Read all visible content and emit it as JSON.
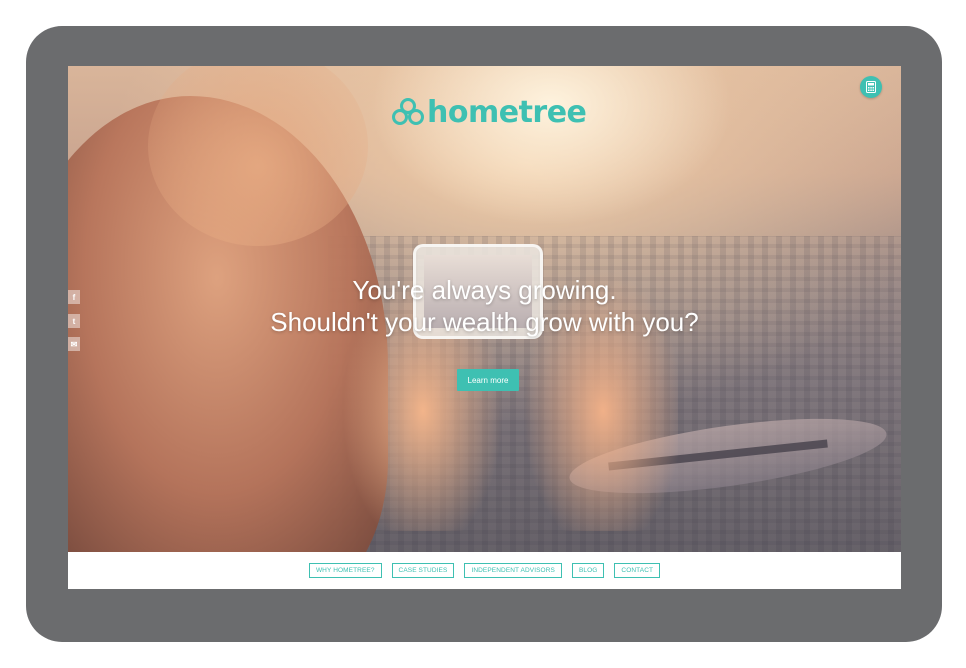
{
  "brand": {
    "name": "hometree",
    "accent_color": "#3ec0b2"
  },
  "header": {
    "calculator_icon": "calculator-icon"
  },
  "hero": {
    "headline_line1": "You're always growing.",
    "headline_line2": "Shouldn't your wealth grow with you?",
    "cta_label": "Learn more"
  },
  "social": {
    "items": [
      {
        "icon": "facebook-icon",
        "glyph": "f"
      },
      {
        "icon": "twitter-icon",
        "glyph": "t"
      },
      {
        "icon": "email-icon",
        "glyph": "✉"
      }
    ]
  },
  "nav": {
    "items": [
      {
        "label": "WHY HOMETREE?"
      },
      {
        "label": "CASE STUDIES"
      },
      {
        "label": "INDEPENDENT ADVISORS"
      },
      {
        "label": "BLOG"
      },
      {
        "label": "CONTACT"
      }
    ]
  }
}
